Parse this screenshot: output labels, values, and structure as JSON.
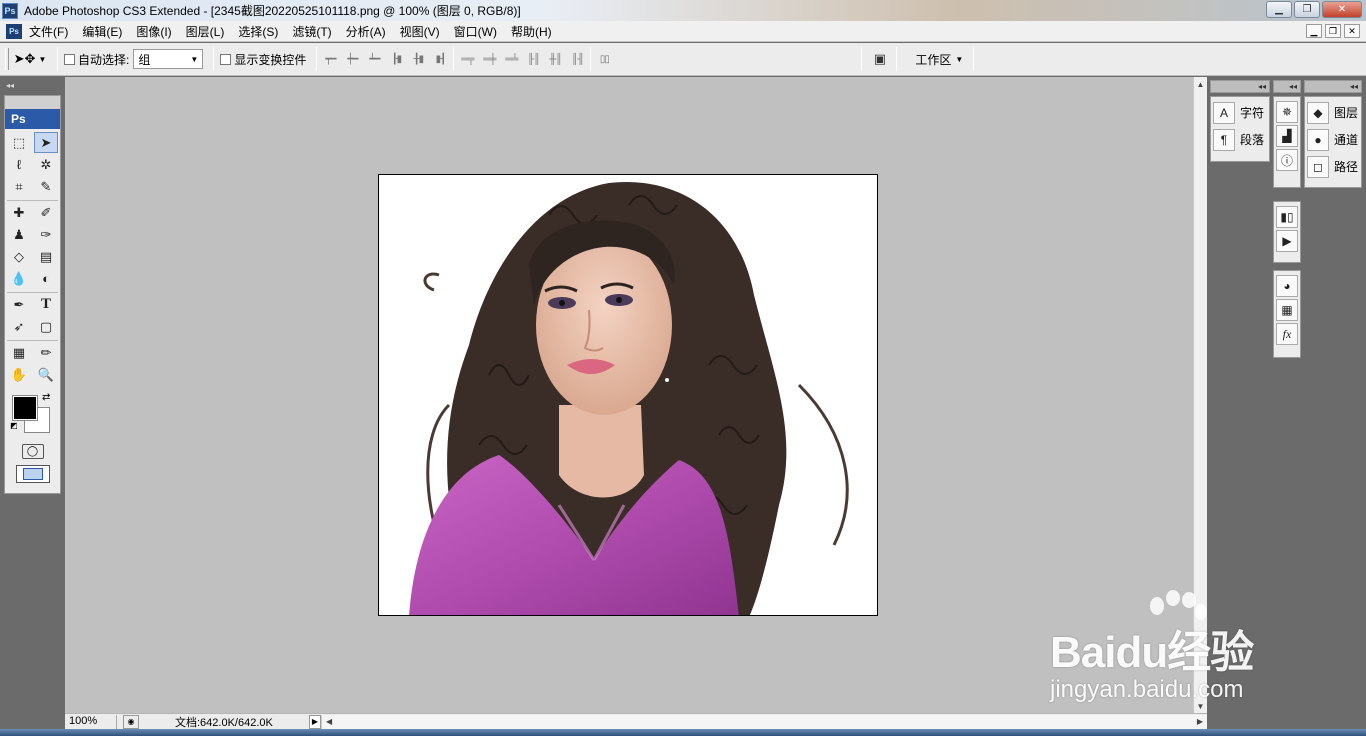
{
  "window": {
    "title": "Adobe Photoshop CS3 Extended - [2345截图20220525101118.png @ 100% (图层 0, RGB/8)]",
    "app_icon": "Ps"
  },
  "menu": {
    "icon": "Ps",
    "items": [
      "文件(F)",
      "编辑(E)",
      "图像(I)",
      "图层(L)",
      "选择(S)",
      "滤镜(T)",
      "分析(A)",
      "视图(V)",
      "窗口(W)",
      "帮助(H)"
    ]
  },
  "options": {
    "auto_select_label": "自动选择:",
    "auto_select_value": "组",
    "show_transform_label": "显示变换控件",
    "workspace_label": "工作区"
  },
  "toolbox": {
    "logo": "Ps"
  },
  "status": {
    "zoom": "100%",
    "doc_size": "文档:642.0K/642.0K"
  },
  "panels": {
    "char": [
      {
        "icon": "A",
        "label": "字符"
      },
      {
        "icon": "¶",
        "label": "段落"
      }
    ],
    "layers": [
      {
        "icon": "◆",
        "label": "图层"
      },
      {
        "icon": "●",
        "label": "通道"
      },
      {
        "icon": "◻",
        "label": "路径"
      }
    ]
  },
  "watermark": {
    "main": "Baidu经验",
    "sub": "jingyan.baidu.com"
  },
  "colors": {
    "foreground": "#000000",
    "background": "#ffffff",
    "canvas_bg": "#c0c0c0",
    "shirt": "#b54fb3",
    "hair": "#2e2420"
  }
}
